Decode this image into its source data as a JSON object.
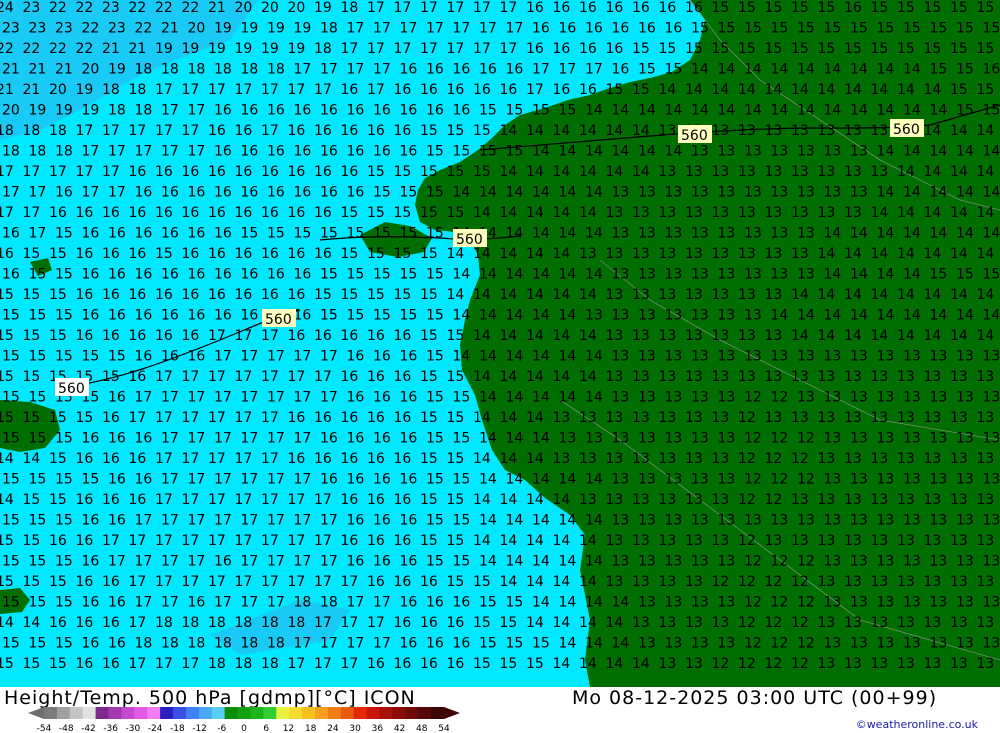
{
  "map": {
    "contour_label": "560",
    "temp_grid": [
      [
        "24",
        "23",
        "22",
        "22",
        "23",
        "22",
        "22",
        "22",
        "21",
        "20",
        "20",
        "20",
        "19",
        "18",
        "17",
        "17",
        "17",
        "17",
        "17",
        "17",
        "16",
        "16",
        "16",
        "16",
        "16",
        "16",
        "16",
        "15",
        "15",
        "15",
        "15",
        "15",
        "16",
        "15",
        "15",
        "15",
        "15",
        "15"
      ],
      [
        "23",
        "23",
        "23",
        "22",
        "23",
        "22",
        "21",
        "20",
        "19",
        "19",
        "19",
        "19",
        "18",
        "17",
        "17",
        "17",
        "17",
        "17",
        "17",
        "17",
        "16",
        "16",
        "16",
        "16",
        "16",
        "16",
        "15",
        "15",
        "15",
        "15",
        "15",
        "15",
        "15",
        "15",
        "15",
        "15",
        "15",
        "15"
      ],
      [
        "22",
        "22",
        "22",
        "22",
        "21",
        "21",
        "19",
        "19",
        "19",
        "19",
        "19",
        "19",
        "18",
        "17",
        "17",
        "17",
        "17",
        "17",
        "17",
        "17",
        "16",
        "16",
        "16",
        "16",
        "15",
        "15",
        "15",
        "15",
        "15",
        "15",
        "15",
        "15",
        "15",
        "15",
        "15",
        "15",
        "15",
        "15"
      ],
      [
        "21",
        "21",
        "21",
        "20",
        "19",
        "18",
        "18",
        "18",
        "18",
        "18",
        "18",
        "17",
        "17",
        "17",
        "17",
        "16",
        "16",
        "16",
        "16",
        "16",
        "17",
        "17",
        "17",
        "16",
        "15",
        "15",
        "14",
        "14",
        "14",
        "14",
        "14",
        "14",
        "14",
        "14",
        "14",
        "15",
        "15",
        "16"
      ],
      [
        "21",
        "21",
        "20",
        "19",
        "18",
        "18",
        "17",
        "17",
        "17",
        "17",
        "17",
        "17",
        "17",
        "16",
        "17",
        "16",
        "16",
        "16",
        "16",
        "16",
        "17",
        "16",
        "16",
        "15",
        "15",
        "14",
        "14",
        "14",
        "14",
        "14",
        "14",
        "14",
        "14",
        "14",
        "14",
        "14",
        "15",
        "15"
      ],
      [
        "20",
        "19",
        "19",
        "19",
        "18",
        "18",
        "17",
        "17",
        "16",
        "16",
        "16",
        "16",
        "16",
        "16",
        "16",
        "16",
        "16",
        "16",
        "15",
        "15",
        "15",
        "15",
        "14",
        "14",
        "14",
        "14",
        "14",
        "14",
        "14",
        "14",
        "14",
        "14",
        "14",
        "14",
        "14",
        "14",
        "15",
        "15"
      ],
      [
        "18",
        "18",
        "18",
        "17",
        "17",
        "17",
        "17",
        "17",
        "16",
        "16",
        "17",
        "16",
        "16",
        "16",
        "16",
        "16",
        "15",
        "15",
        "15",
        "14",
        "14",
        "14",
        "14",
        "14",
        "14",
        "13",
        "13",
        "13",
        "13",
        "13",
        "13",
        "13",
        "13",
        "13",
        "14",
        "14",
        "14",
        "14"
      ],
      [
        "18",
        "18",
        "18",
        "17",
        "17",
        "17",
        "17",
        "17",
        "16",
        "16",
        "16",
        "16",
        "16",
        "16",
        "16",
        "16",
        "15",
        "15",
        "15",
        "15",
        "14",
        "14",
        "14",
        "14",
        "14",
        "14",
        "13",
        "13",
        "13",
        "13",
        "13",
        "13",
        "13",
        "14",
        "14",
        "14",
        "14",
        "14"
      ],
      [
        "17",
        "17",
        "17",
        "17",
        "17",
        "16",
        "16",
        "16",
        "16",
        "16",
        "16",
        "16",
        "16",
        "16",
        "15",
        "15",
        "15",
        "15",
        "15",
        "14",
        "14",
        "14",
        "14",
        "14",
        "14",
        "13",
        "13",
        "13",
        "13",
        "13",
        "13",
        "13",
        "13",
        "13",
        "14",
        "14",
        "14",
        "14"
      ],
      [
        "17",
        "17",
        "16",
        "17",
        "17",
        "16",
        "16",
        "16",
        "16",
        "16",
        "16",
        "16",
        "16",
        "16",
        "15",
        "15",
        "15",
        "14",
        "14",
        "14",
        "14",
        "14",
        "14",
        "13",
        "13",
        "13",
        "13",
        "13",
        "13",
        "13",
        "13",
        "13",
        "13",
        "14",
        "14",
        "14",
        "14",
        "14"
      ],
      [
        "17",
        "17",
        "16",
        "16",
        "16",
        "16",
        "16",
        "16",
        "16",
        "16",
        "16",
        "16",
        "16",
        "15",
        "15",
        "15",
        "15",
        "15",
        "14",
        "14",
        "14",
        "14",
        "14",
        "13",
        "13",
        "13",
        "13",
        "13",
        "13",
        "13",
        "13",
        "13",
        "13",
        "14",
        "14",
        "14",
        "14",
        "14"
      ],
      [
        "16",
        "17",
        "15",
        "16",
        "16",
        "16",
        "16",
        "16",
        "16",
        "15",
        "15",
        "15",
        "15",
        "15",
        "15",
        "15",
        "15",
        "14",
        "14",
        "14",
        "14",
        "14",
        "14",
        "13",
        "13",
        "13",
        "13",
        "13",
        "13",
        "13",
        "13",
        "14",
        "14",
        "14",
        "14",
        "14",
        "14",
        "14"
      ],
      [
        "16",
        "15",
        "15",
        "16",
        "16",
        "16",
        "15",
        "16",
        "16",
        "16",
        "16",
        "16",
        "16",
        "15",
        "15",
        "15",
        "15",
        "14",
        "14",
        "14",
        "14",
        "14",
        "13",
        "13",
        "13",
        "13",
        "13",
        "13",
        "13",
        "13",
        "13",
        "14",
        "14",
        "14",
        "14",
        "14",
        "14",
        "14"
      ],
      [
        "16",
        "15",
        "15",
        "16",
        "16",
        "16",
        "16",
        "16",
        "16",
        "16",
        "16",
        "16",
        "15",
        "15",
        "15",
        "15",
        "15",
        "14",
        "14",
        "14",
        "14",
        "14",
        "14",
        "13",
        "13",
        "13",
        "13",
        "13",
        "13",
        "13",
        "13",
        "14",
        "14",
        "14",
        "14",
        "15",
        "15",
        "15"
      ],
      [
        "15",
        "15",
        "15",
        "16",
        "16",
        "16",
        "16",
        "16",
        "16",
        "16",
        "16",
        "16",
        "15",
        "15",
        "15",
        "15",
        "15",
        "14",
        "14",
        "14",
        "14",
        "14",
        "14",
        "13",
        "13",
        "13",
        "13",
        "13",
        "13",
        "13",
        "14",
        "14",
        "14",
        "14",
        "14",
        "14",
        "14",
        "14"
      ],
      [
        "15",
        "15",
        "15",
        "16",
        "16",
        "16",
        "16",
        "16",
        "16",
        "16",
        "16",
        "16",
        "15",
        "15",
        "15",
        "15",
        "15",
        "14",
        "14",
        "14",
        "14",
        "14",
        "13",
        "13",
        "13",
        "13",
        "13",
        "13",
        "13",
        "14",
        "14",
        "14",
        "14",
        "14",
        "14",
        "14",
        "14",
        "14"
      ],
      [
        "15",
        "15",
        "15",
        "16",
        "16",
        "16",
        "16",
        "16",
        "17",
        "17",
        "17",
        "16",
        "16",
        "16",
        "16",
        "16",
        "15",
        "15",
        "14",
        "14",
        "14",
        "14",
        "14",
        "13",
        "13",
        "13",
        "13",
        "13",
        "13",
        "13",
        "14",
        "14",
        "14",
        "14",
        "14",
        "14",
        "14",
        "14"
      ],
      [
        "15",
        "15",
        "15",
        "15",
        "15",
        "16",
        "16",
        "16",
        "17",
        "17",
        "17",
        "17",
        "17",
        "16",
        "16",
        "16",
        "15",
        "14",
        "14",
        "14",
        "14",
        "14",
        "14",
        "13",
        "13",
        "13",
        "13",
        "13",
        "13",
        "13",
        "13",
        "13",
        "13",
        "13",
        "13",
        "13",
        "13",
        "13"
      ],
      [
        "15",
        "15",
        "15",
        "15",
        "15",
        "16",
        "17",
        "17",
        "17",
        "17",
        "17",
        "17",
        "17",
        "16",
        "16",
        "16",
        "15",
        "15",
        "14",
        "14",
        "14",
        "14",
        "14",
        "13",
        "13",
        "13",
        "13",
        "13",
        "13",
        "13",
        "13",
        "13",
        "13",
        "13",
        "13",
        "13",
        "13",
        "13"
      ],
      [
        "15",
        "15",
        "15",
        "15",
        "16",
        "17",
        "17",
        "17",
        "17",
        "17",
        "17",
        "17",
        "17",
        "16",
        "16",
        "16",
        "15",
        "15",
        "14",
        "14",
        "14",
        "14",
        "14",
        "13",
        "13",
        "13",
        "13",
        "13",
        "12",
        "12",
        "13",
        "13",
        "13",
        "13",
        "13",
        "13",
        "13",
        "13"
      ],
      [
        "15",
        "15",
        "15",
        "15",
        "16",
        "17",
        "17",
        "17",
        "17",
        "17",
        "17",
        "16",
        "16",
        "16",
        "16",
        "16",
        "15",
        "15",
        "14",
        "14",
        "14",
        "13",
        "13",
        "13",
        "13",
        "13",
        "13",
        "13",
        "12",
        "13",
        "13",
        "13",
        "13",
        "13",
        "13",
        "13",
        "13",
        "13"
      ],
      [
        "15",
        "15",
        "15",
        "16",
        "16",
        "16",
        "17",
        "17",
        "17",
        "17",
        "17",
        "17",
        "16",
        "16",
        "16",
        "16",
        "15",
        "15",
        "14",
        "14",
        "14",
        "13",
        "13",
        "13",
        "13",
        "13",
        "13",
        "13",
        "12",
        "12",
        "12",
        "13",
        "13",
        "13",
        "13",
        "13",
        "13",
        "13"
      ],
      [
        "14",
        "14",
        "15",
        "16",
        "16",
        "16",
        "17",
        "17",
        "17",
        "17",
        "17",
        "16",
        "16",
        "16",
        "16",
        "16",
        "15",
        "15",
        "14",
        "14",
        "14",
        "13",
        "13",
        "13",
        "13",
        "13",
        "13",
        "13",
        "12",
        "12",
        "12",
        "13",
        "13",
        "13",
        "13",
        "13",
        "13",
        "13"
      ],
      [
        "15",
        "15",
        "15",
        "15",
        "16",
        "16",
        "17",
        "17",
        "17",
        "17",
        "17",
        "17",
        "16",
        "16",
        "16",
        "16",
        "15",
        "15",
        "14",
        "14",
        "14",
        "14",
        "14",
        "13",
        "13",
        "13",
        "13",
        "13",
        "12",
        "12",
        "12",
        "13",
        "13",
        "13",
        "13",
        "13",
        "13",
        "13"
      ],
      [
        "14",
        "15",
        "15",
        "16",
        "16",
        "16",
        "17",
        "17",
        "17",
        "17",
        "17",
        "17",
        "17",
        "16",
        "16",
        "16",
        "15",
        "15",
        "14",
        "14",
        "14",
        "14",
        "13",
        "13",
        "13",
        "13",
        "13",
        "13",
        "12",
        "12",
        "13",
        "13",
        "13",
        "13",
        "13",
        "13",
        "13",
        "13"
      ],
      [
        "15",
        "15",
        "15",
        "16",
        "16",
        "17",
        "17",
        "17",
        "17",
        "17",
        "17",
        "17",
        "17",
        "16",
        "16",
        "16",
        "15",
        "15",
        "14",
        "14",
        "14",
        "14",
        "14",
        "13",
        "13",
        "13",
        "13",
        "13",
        "13",
        "13",
        "13",
        "13",
        "13",
        "13",
        "13",
        "13",
        "13",
        "13"
      ],
      [
        "15",
        "15",
        "16",
        "16",
        "17",
        "17",
        "17",
        "17",
        "17",
        "17",
        "17",
        "17",
        "17",
        "16",
        "16",
        "16",
        "15",
        "15",
        "14",
        "14",
        "14",
        "14",
        "14",
        "13",
        "13",
        "13",
        "13",
        "13",
        "12",
        "13",
        "13",
        "13",
        "13",
        "13",
        "13",
        "13",
        "13",
        "13"
      ],
      [
        "15",
        "15",
        "15",
        "16",
        "17",
        "17",
        "17",
        "17",
        "16",
        "17",
        "17",
        "17",
        "17",
        "16",
        "16",
        "16",
        "15",
        "15",
        "14",
        "14",
        "14",
        "14",
        "14",
        "13",
        "13",
        "13",
        "13",
        "13",
        "12",
        "12",
        "12",
        "13",
        "13",
        "13",
        "13",
        "13",
        "13",
        "13"
      ],
      [
        "15",
        "15",
        "15",
        "16",
        "16",
        "17",
        "17",
        "17",
        "17",
        "17",
        "17",
        "17",
        "17",
        "17",
        "16",
        "16",
        "16",
        "15",
        "15",
        "14",
        "14",
        "14",
        "14",
        "13",
        "13",
        "13",
        "13",
        "12",
        "12",
        "12",
        "12",
        "13",
        "13",
        "13",
        "13",
        "13",
        "13",
        "13"
      ],
      [
        "15",
        "15",
        "15",
        "16",
        "16",
        "17",
        "17",
        "16",
        "17",
        "17",
        "17",
        "18",
        "18",
        "17",
        "17",
        "16",
        "16",
        "16",
        "15",
        "15",
        "14",
        "14",
        "14",
        "14",
        "13",
        "13",
        "13",
        "13",
        "12",
        "12",
        "12",
        "13",
        "13",
        "13",
        "13",
        "13",
        "13",
        "13"
      ],
      [
        "14",
        "14",
        "16",
        "16",
        "16",
        "17",
        "18",
        "18",
        "18",
        "18",
        "18",
        "18",
        "17",
        "17",
        "17",
        "16",
        "16",
        "16",
        "15",
        "15",
        "14",
        "14",
        "14",
        "14",
        "13",
        "13",
        "13",
        "13",
        "12",
        "12",
        "12",
        "13",
        "13",
        "13",
        "13",
        "13",
        "13",
        "13"
      ],
      [
        "15",
        "15",
        "15",
        "16",
        "16",
        "18",
        "18",
        "18",
        "18",
        "18",
        "18",
        "17",
        "17",
        "17",
        "17",
        "16",
        "16",
        "16",
        "15",
        "15",
        "15",
        "14",
        "14",
        "14",
        "13",
        "13",
        "13",
        "13",
        "12",
        "12",
        "12",
        "13",
        "13",
        "13",
        "13",
        "13",
        "13",
        "13"
      ],
      [
        "15",
        "15",
        "15",
        "16",
        "16",
        "17",
        "17",
        "17",
        "18",
        "18",
        "18",
        "17",
        "17",
        "17",
        "16",
        "16",
        "16",
        "16",
        "15",
        "15",
        "15",
        "14",
        "14",
        "14",
        "14",
        "13",
        "13",
        "12",
        "12",
        "12",
        "12",
        "13",
        "13",
        "13",
        "13",
        "13",
        "13",
        "13"
      ]
    ]
  },
  "footer": {
    "title_left": "Height/Temp. 500 hPa [gdmp][°C] ICON",
    "title_right": "Mo 08-12-2025 03:00 UTC (00+99)",
    "credit": "©weatheronline.co.uk",
    "scale_ticks": [
      "-54",
      "-48",
      "-42",
      "-36",
      "-30",
      "-24",
      "-18",
      "-12",
      "-6",
      "0",
      "6",
      "12",
      "18",
      "24",
      "30",
      "36",
      "42",
      "48",
      "54"
    ],
    "scale_colors": [
      "#7b7b7b",
      "#a0a0a0",
      "#c4c4c4",
      "#e0e0e0",
      "#7d2a8c",
      "#a03aad",
      "#c54ad0",
      "#e45ae8",
      "#f27ff2",
      "#2a1fc0",
      "#3b4fe8",
      "#3f82f5",
      "#4aa8f5",
      "#58cff2",
      "#0a8c0a",
      "#14a014",
      "#1eb41e",
      "#34cc34",
      "#e8f040",
      "#f2dd2e",
      "#f5c01e",
      "#f5a01e",
      "#f07e14",
      "#e85a0e",
      "#e6280a",
      "#c8140a",
      "#a8100a",
      "#8c0c0a",
      "#700a0a",
      "#560808",
      "#3c0606"
    ]
  }
}
